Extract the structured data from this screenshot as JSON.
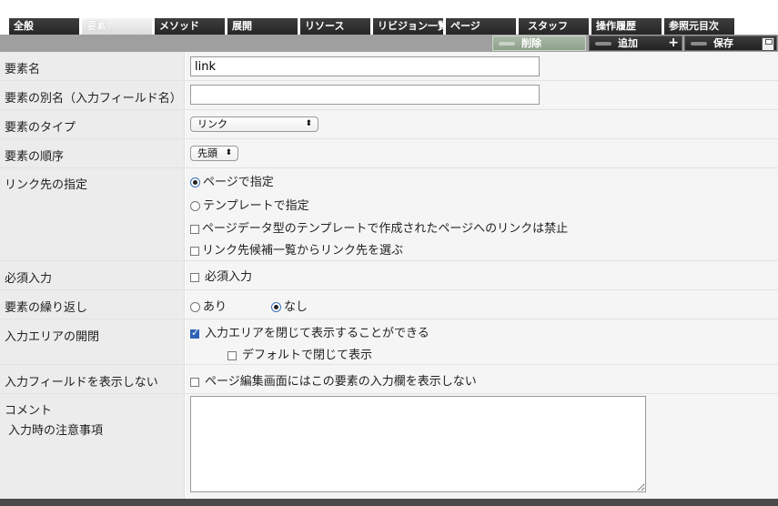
{
  "tabs": [
    {
      "label": "全般"
    },
    {
      "label": "要素"
    },
    {
      "label": "メソッド"
    },
    {
      "label": "展開"
    },
    {
      "label": "リソース"
    },
    {
      "label": "リビジョン一覧"
    },
    {
      "label": "ページ"
    },
    {
      "label": "スタッフ"
    },
    {
      "label": "操作履歴"
    },
    {
      "label": "参照元目次"
    }
  ],
  "toolbar": {
    "delete_label": "削除",
    "add_label": "追加",
    "add_plus": "+",
    "save_label": "保存"
  },
  "form": {
    "name": {
      "label": "要素名",
      "value": "link"
    },
    "alias": {
      "label": "要素の別名（入力フィールド名）",
      "value": ""
    },
    "type": {
      "label": "要素のタイプ",
      "selected": "リンク",
      "arrow": "⬍"
    },
    "order": {
      "label": "要素の順序",
      "selected": "先頭",
      "arrow": "⬍"
    },
    "link_target": {
      "label": "リンク先の指定",
      "opt_page": "ページで指定",
      "opt_template": "テンプレートで指定",
      "chk_forbid": "ページデータ型のテンプレートで作成されたページへのリンクは禁止",
      "chk_candidates": "リンク先候補一覧からリンク先を選ぶ"
    },
    "required": {
      "label": "必須入力",
      "check": "必須入力"
    },
    "repeat": {
      "label": "要素の繰り返し",
      "yes": "あり",
      "no": "なし"
    },
    "collapse": {
      "label": "入力エリアの開閉",
      "check": "入力エリアを閉じて表示することができる",
      "default_closed": "デフォルトで閉じて表示"
    },
    "hide_field": {
      "label": "入力フィールドを表示しない",
      "check": "ページ編集画面にはこの要素の入力欄を表示しない"
    },
    "comment": {
      "label": "コメント",
      "sublabel": "入力時の注意事項",
      "value": ""
    }
  }
}
